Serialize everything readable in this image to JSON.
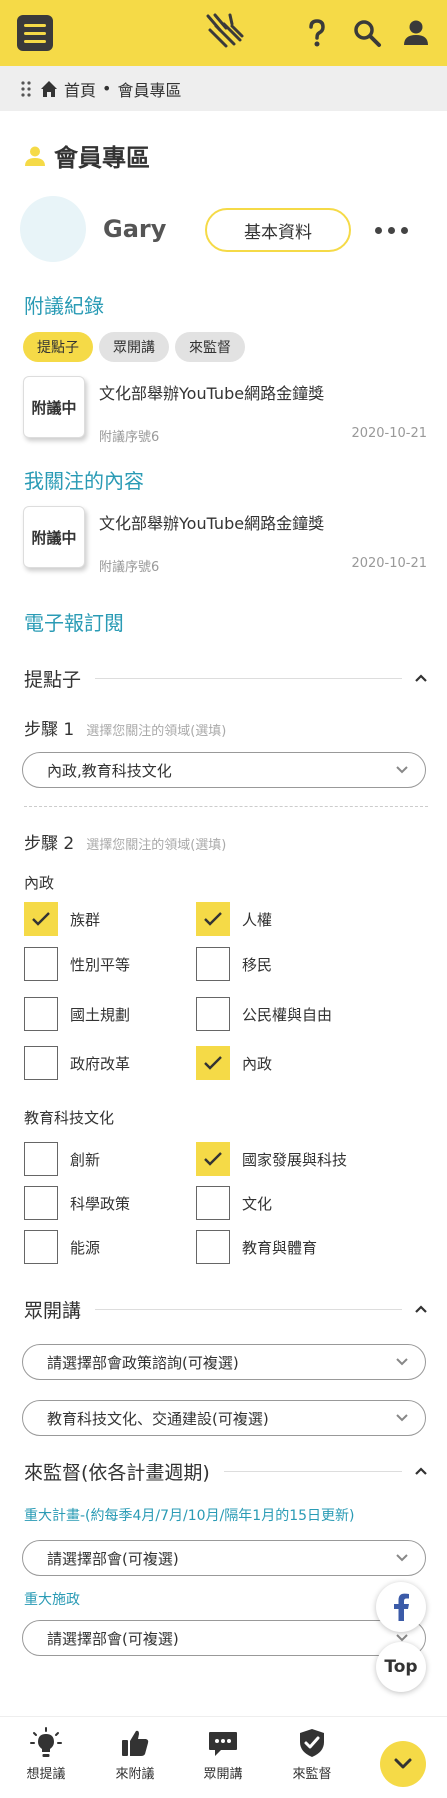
{
  "colors": {
    "brand": "#f5da47",
    "accent_blue": "#2a9bb5",
    "dark": "#3a3a3a"
  },
  "header": {
    "menu_icon": "hamburger-icon",
    "logo_icon": "join-logo-hands",
    "icons": [
      "help-icon",
      "search-icon",
      "user-icon"
    ]
  },
  "breadcrumb": {
    "home": "首頁",
    "separator": "•",
    "current": "會員專區"
  },
  "page_title": "會員專區",
  "profile": {
    "name": "Gary",
    "edit_button": "基本資料",
    "more_icon": "ellipsis-icon"
  },
  "records": {
    "title": "附議紀錄",
    "filters": [
      {
        "label": "提點子",
        "active": true
      },
      {
        "label": "眾開講",
        "active": false
      },
      {
        "label": "來監督",
        "active": false
      }
    ],
    "items": [
      {
        "stamp": "附議中",
        "title": "文化部舉辦YouTube網路金鐘獎",
        "no": "附議序號6",
        "date": "2020-10-21"
      }
    ]
  },
  "following": {
    "title": "我關注的內容",
    "items": [
      {
        "stamp": "附議中",
        "title": "文化部舉辦YouTube網路金鐘獎",
        "no": "附議序號6",
        "date": "2020-10-21"
      }
    ]
  },
  "newsletter": {
    "title": "電子報訂閱",
    "idea": {
      "title": "提點子",
      "step1": {
        "label": "步驟 1",
        "hint": "選擇您關注的領域(選填)",
        "value": "內政,教育科技文化"
      },
      "step2": {
        "label": "步驟 2",
        "hint": "選擇您關注的領域(選填)"
      },
      "groups": [
        {
          "name": "內政",
          "options": [
            {
              "label": "族群",
              "checked": true
            },
            {
              "label": "人權",
              "checked": true
            },
            {
              "label": "性別平等",
              "checked": false
            },
            {
              "label": "移民",
              "checked": false
            },
            {
              "label": "國土規劃",
              "checked": false
            },
            {
              "label": "公民權與自由",
              "checked": false
            },
            {
              "label": "政府改革",
              "checked": false
            },
            {
              "label": "內政",
              "checked": true
            }
          ]
        },
        {
          "name": "教育科技文化",
          "options": [
            {
              "label": "創新",
              "checked": false
            },
            {
              "label": "國家發展與科技",
              "checked": true
            },
            {
              "label": "科學政策",
              "checked": false
            },
            {
              "label": "文化",
              "checked": false
            },
            {
              "label": "能源",
              "checked": false
            },
            {
              "label": "教育與體育",
              "checked": false
            }
          ]
        }
      ]
    },
    "forum": {
      "title": "眾開講",
      "select1": "請選擇部會政策諮詢(可複選)",
      "select2": "教育科技文化、交通建設(可複選)"
    },
    "monitor": {
      "title": "來監督(依各計畫週期)",
      "major_plan_label": "重大計畫-(約每季4月/7月/10月/隔年1月的15日更新)",
      "major_plan_select": "請選擇部會(可複選)",
      "major_work_label": "重大施政",
      "major_work_select": "請選擇部會(可複選)"
    }
  },
  "floating": {
    "facebook_icon": "facebook-icon",
    "top_label": "Top"
  },
  "bottom_nav": {
    "items": [
      {
        "label": "想提議",
        "icon": "lightbulb-icon"
      },
      {
        "label": "來附議",
        "icon": "thumbs-up-icon"
      },
      {
        "label": "眾開講",
        "icon": "chat-icon"
      },
      {
        "label": "來監督",
        "icon": "shield-check-icon"
      }
    ],
    "scroll_icon": "chevron-down-icon"
  }
}
